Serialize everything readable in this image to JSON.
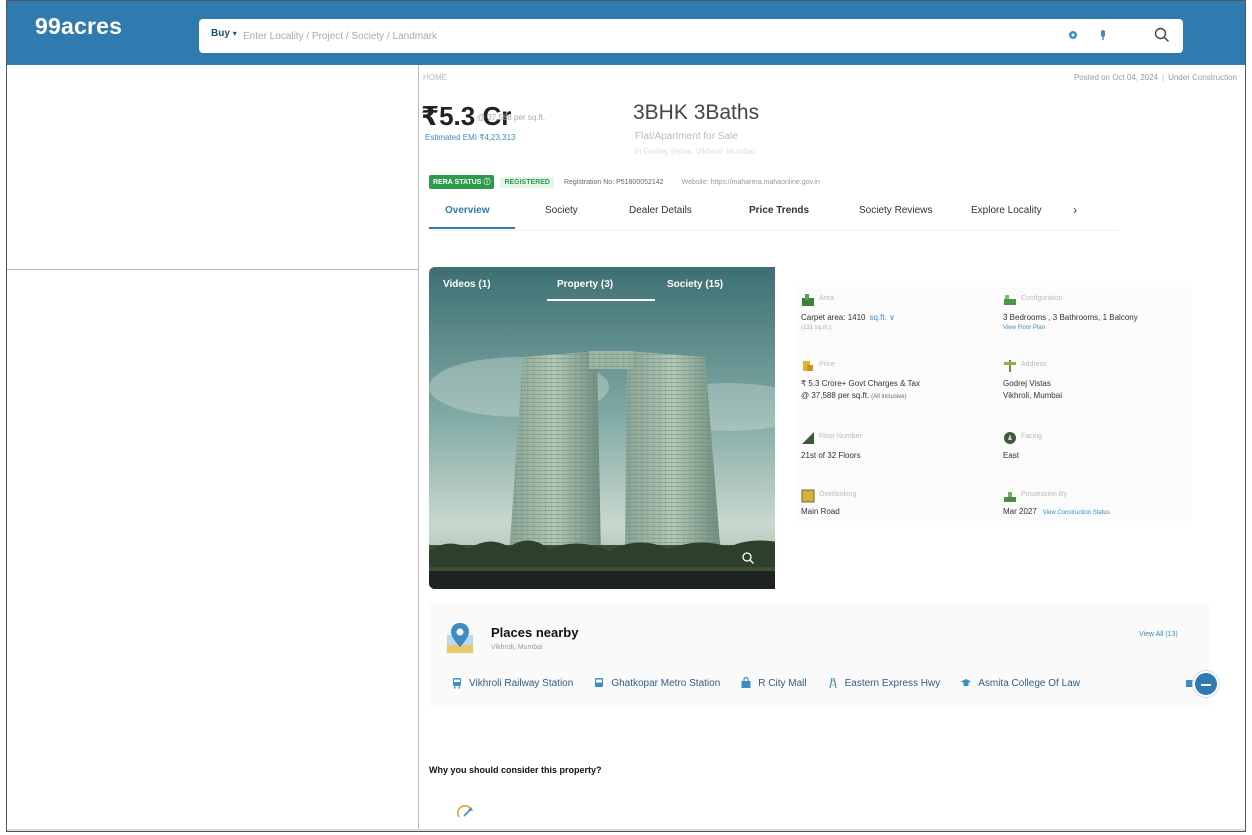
{
  "header": {
    "logo": "99acres",
    "search_mode": "Buy",
    "search_placeholder": "Enter Locality / Project / Society / Landmark"
  },
  "listing": {
    "breadcrumb": "HOME",
    "posted_on": "Posted on Oct 04, 2024",
    "status": "Under Construction",
    "price": "₹5.3 Cr",
    "price_per_sqft": "@ 37,588 per sq.ft.",
    "estimated_emi": "Estimated EMI ₹4,23,313",
    "bhk": "3BHK 3Baths",
    "property_type": "Flat/Apartment for Sale",
    "address_line": "in Godrej Vistas, Vikhroli, Mumbai",
    "rera_status_label": "RERA STATUS",
    "rera_registered": "REGISTERED",
    "registration_no": "Registration No: P51800052142",
    "website": "Website: https://maharera.mahaonline.gov.in"
  },
  "tabs": [
    {
      "label": "Overview",
      "active": true
    },
    {
      "label": "Society",
      "active": false
    },
    {
      "label": "Dealer Details",
      "active": false
    },
    {
      "label": "Price Trends",
      "active": false
    },
    {
      "label": "Society Reviews",
      "active": false
    },
    {
      "label": "Explore Locality",
      "active": false
    }
  ],
  "tabs_next": "›",
  "gallery": {
    "tabs": [
      {
        "label": "Videos (1)"
      },
      {
        "label": "Property (3)"
      },
      {
        "label": "Society (15)"
      }
    ]
  },
  "details": {
    "area": {
      "label": "Area",
      "value": "Carpet area: 1410",
      "unit": "sq.ft. ∨",
      "sub": "(131 sq.m.)"
    },
    "configuration": {
      "label": "Configuration",
      "value": "3 Bedrooms , 3 Bathrooms, 1 Balcony",
      "sub": "View Floor Plan"
    },
    "price": {
      "label": "Price",
      "value": "₹ 5.3 Crore+ Govt Charges & Tax",
      "value2": "@ 37,588 per sq.ft.",
      "tag": "(All inclusive)"
    },
    "address": {
      "label": "Address",
      "value": "Godrej Vistas",
      "value2": "Vikhroli, Mumbai"
    },
    "floor": {
      "label": "Floor Number",
      "value": "21st  of 32 Floors"
    },
    "facing": {
      "label": "Facing",
      "value": "East"
    },
    "overlooking": {
      "label": "Overlooking",
      "value": "Main Road"
    },
    "possession": {
      "label": "Possession By",
      "value": "Mar 2027",
      "link": "View Construction Status"
    }
  },
  "places": {
    "title": "Places nearby",
    "subtitle": "Vikhroli, Mumbai",
    "view_all": "View All (13)",
    "items": [
      {
        "label": "Vikhroli Railway Station"
      },
      {
        "label": "Ghatkopar Metro Station"
      },
      {
        "label": "R City Mall"
      },
      {
        "label": "Eastern Express Hwy"
      },
      {
        "label": "Asmita College Of Law"
      }
    ]
  },
  "why": "Why you should consider this property?",
  "colors": {
    "brand": "#2f7bb0",
    "rera_green": "#2e9a4c",
    "link": "#3d8dc4"
  }
}
